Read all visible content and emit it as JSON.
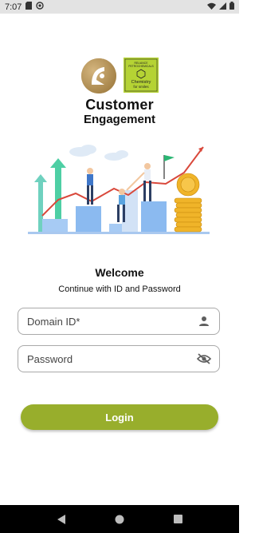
{
  "status_bar": {
    "time": "7:07",
    "icons": [
      "sd-card-icon",
      "at-sign-icon",
      "wifi-icon",
      "signal-icon",
      "battery-icon"
    ]
  },
  "logos": {
    "brand_logo": "reliance-logo",
    "partner_logo_text": [
      "RELIANCE PETROCHEMICALS",
      "Chemistry",
      "for smiles"
    ],
    "partner_logo_color": "#b5d334"
  },
  "title": {
    "line1": "Customer",
    "line2": "Engagement"
  },
  "welcome": {
    "heading": "Welcome",
    "subtitle": "Continue with ID and Password"
  },
  "form": {
    "domain_id_placeholder": "Domain ID*",
    "domain_id_value": "",
    "domain_id_icon": "person-icon",
    "password_placeholder": "Password",
    "password_value": "",
    "password_icon": "visibility-off-icon"
  },
  "login_button": {
    "label": "Login",
    "color": "#98ae2c"
  },
  "nav_bar": {
    "buttons": [
      "back-icon",
      "home-icon",
      "recents-icon"
    ]
  }
}
